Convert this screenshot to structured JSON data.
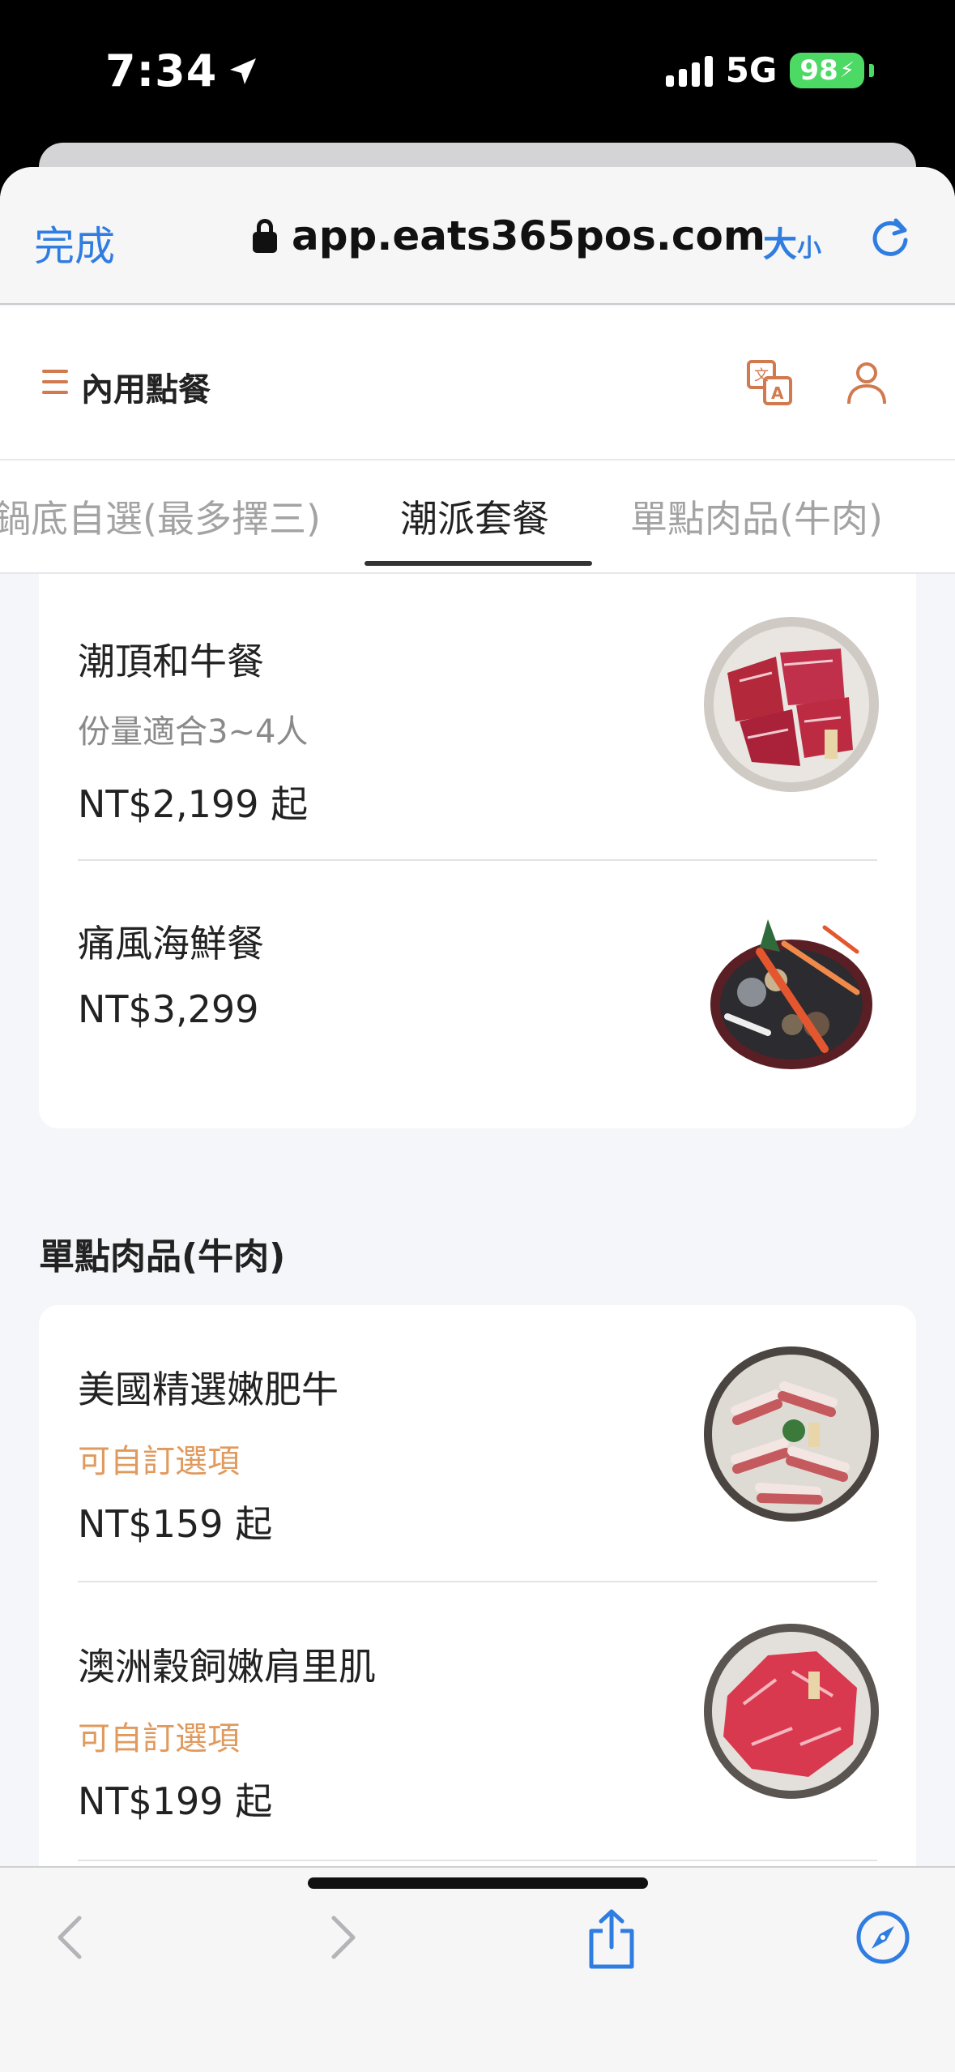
{
  "status_bar": {
    "time": "7:34",
    "network": "5G",
    "battery": "98"
  },
  "browser": {
    "done_label": "完成",
    "url": "app.eats365pos.com",
    "size_label_big": "大",
    "size_label_small": "小"
  },
  "header": {
    "title": "內用點餐"
  },
  "tabs": [
    {
      "label": "鍋底自選(最多擇三)"
    },
    {
      "label": "潮派套餐"
    },
    {
      "label": "單點肉品(牛肉)"
    }
  ],
  "set_items": [
    {
      "name": "潮頂和牛餐",
      "note": "份量適合3~4人",
      "price": "NT$2,199 起",
      "image_icon": "wagyu-plate-image"
    },
    {
      "name": "痛風海鮮餐",
      "price": "NT$3,299",
      "image_icon": "seafood-platter-image"
    }
  ],
  "beef_section": {
    "title": "單點肉品(牛肉)"
  },
  "beef_items": [
    {
      "name": "美國精選嫩肥牛",
      "note": "可自訂選項",
      "price": "NT$159 起",
      "image_icon": "beef-slices-image"
    },
    {
      "name": "澳洲穀飼嫩肩里肌",
      "note": "可自訂選項",
      "price": "NT$199 起",
      "image_icon": "shoulder-loin-image"
    }
  ],
  "colors": {
    "accent": "#2f7de1",
    "brand": "#d07a4e",
    "option_note": "#e09a5e"
  }
}
